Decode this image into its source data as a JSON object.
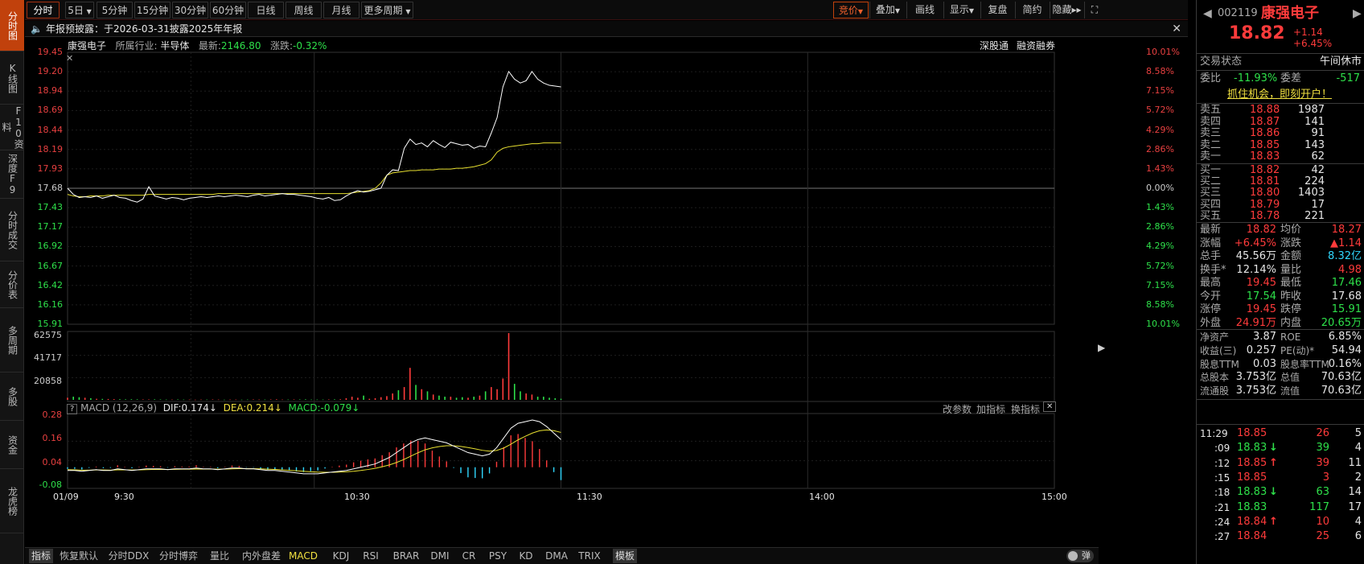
{
  "left_tabs": [
    "分时图",
    "K线图",
    "F10资料",
    "深度F9",
    "分时成交",
    "分价表",
    "多周期",
    "多股",
    "资金",
    "龙虎榜"
  ],
  "top_tabs": [
    "分时",
    "5日",
    "5分钟",
    "15分钟",
    "30分钟",
    "60分钟",
    "日线",
    "周线",
    "月线",
    "更多周期"
  ],
  "top_tools": [
    "竞价",
    "叠加",
    "画线",
    "显示",
    "复盘",
    "简约",
    "隐藏"
  ],
  "notice": "年报预披露：于2026-03-31披露2025年年报",
  "info": {
    "name": "康强电子",
    "industry_label": "所属行业:",
    "industry": "半导体",
    "latest_label": "最新:",
    "latest": "2146.80",
    "change_label": "涨跌:",
    "change": "-0.32%",
    "tag1": "深股通",
    "tag2": "融资融券"
  },
  "price_axis": {
    "left": [
      "19.45",
      "19.20",
      "18.94",
      "18.69",
      "18.44",
      "18.19",
      "17.93",
      "17.68",
      "17.43",
      "17.17",
      "16.92",
      "16.67",
      "16.42",
      "16.16",
      "15.91"
    ],
    "right": [
      "10.01%",
      "8.58%",
      "7.15%",
      "5.72%",
      "4.29%",
      "2.86%",
      "1.43%",
      "0.00%",
      "1.43%",
      "2.86%",
      "4.29%",
      "5.72%",
      "7.15%",
      "8.58%",
      "10.01%"
    ]
  },
  "volume_axis": [
    "62575",
    "41717",
    "20858"
  ],
  "macd": {
    "title": "MACD (12,26,9)",
    "dif": "DIF:0.174↓",
    "dea": "DEA:0.214↓",
    "macd": "MACD:-0.079↓",
    "btn1": "改参数",
    "btn2": "加指标",
    "btn3": "换指标",
    "axis": [
      "0.28",
      "0.16",
      "0.04",
      "-0.08"
    ]
  },
  "time_axis": [
    "01/09",
    "9:30",
    "10:30",
    "11:30",
    "14:00",
    "15:00"
  ],
  "bottom_tabs": [
    "指标",
    "恢复默认",
    "分时DDX",
    "分时博弈",
    "量比",
    "内外盘差",
    "MACD",
    "KDJ",
    "RSI",
    "BRAR",
    "DMI",
    "CR",
    "PSY",
    "KD",
    "DMA",
    "TRIX",
    "模板"
  ],
  "bottom_right": "弹",
  "chart_data": {
    "type": "line",
    "price_range": [
      15.91,
      19.45
    ],
    "prev_close": 17.68,
    "price": [
      17.68,
      17.6,
      17.56,
      17.57,
      17.56,
      17.58,
      17.55,
      17.57,
      17.59,
      17.56,
      17.55,
      17.52,
      17.5,
      17.54,
      17.7,
      17.58,
      17.56,
      17.54,
      17.56,
      17.55,
      17.53,
      17.55,
      17.56,
      17.57,
      17.56,
      17.57,
      17.58,
      17.57,
      17.58,
      17.59,
      17.58,
      17.57,
      17.59,
      17.6,
      17.58,
      17.59,
      17.6,
      17.61,
      17.6,
      17.6,
      17.59,
      17.58,
      17.57,
      17.55,
      17.54,
      17.56,
      17.52,
      17.53,
      17.58,
      17.62,
      17.65,
      17.63,
      17.64,
      17.66,
      17.68,
      17.85,
      17.92,
      17.91,
      18.2,
      18.32,
      18.25,
      18.27,
      18.22,
      18.3,
      18.25,
      18.21,
      18.28,
      18.26,
      18.24,
      18.25,
      18.2,
      18.23,
      18.22,
      18.4,
      18.6,
      19.0,
      19.2,
      19.1,
      19.05,
      19.08,
      19.2,
      19.1,
      19.05,
      19.02,
      19.01,
      19.0
    ],
    "avg_price": [
      17.6,
      17.58,
      17.57,
      17.57,
      17.58,
      17.58,
      17.58,
      17.59,
      17.59,
      17.59,
      17.59,
      17.59,
      17.59,
      17.59,
      17.6,
      17.6,
      17.6,
      17.6,
      17.6,
      17.6,
      17.6,
      17.6,
      17.6,
      17.6,
      17.6,
      17.6,
      17.61,
      17.61,
      17.61,
      17.61,
      17.61,
      17.61,
      17.61,
      17.61,
      17.61,
      17.61,
      17.61,
      17.61,
      17.61,
      17.61,
      17.61,
      17.61,
      17.61,
      17.61,
      17.61,
      17.61,
      17.61,
      17.61,
      17.61,
      17.62,
      17.63,
      17.64,
      17.65,
      17.68,
      17.75,
      17.85,
      17.88,
      17.89,
      17.9,
      17.91,
      17.91,
      17.92,
      17.92,
      17.92,
      17.93,
      17.93,
      17.93,
      17.94,
      17.94,
      17.95,
      17.96,
      17.98,
      18.0,
      18.05,
      18.15,
      18.2,
      18.22,
      18.23,
      18.24,
      18.25,
      18.26,
      18.26,
      18.27,
      18.27,
      18.27,
      18.27
    ],
    "volume_max": 62575,
    "volume": [
      2000,
      3000,
      2500,
      2000,
      1500,
      1000,
      900,
      800,
      700,
      600,
      500,
      600,
      500,
      400,
      400,
      500,
      400,
      300,
      300,
      400,
      300,
      300,
      200,
      300,
      300,
      400,
      300,
      200,
      300,
      300,
      200,
      300,
      400,
      300,
      300,
      400,
      500,
      300,
      300,
      400,
      400,
      500,
      300,
      300,
      300,
      400,
      500,
      600,
      1500,
      3000,
      2000,
      4000,
      1000,
      1500,
      2500,
      3500,
      6000,
      9000,
      12000,
      30000,
      14000,
      10000,
      8000,
      5000,
      4000,
      3000,
      3000,
      2000,
      2500,
      2000,
      3000,
      4000,
      8000,
      12000,
      10000,
      20000,
      62575,
      15000,
      8000,
      6000,
      5000,
      3000,
      3000,
      2000,
      1500,
      1000
    ],
    "macd_range": [
      -0.12,
      0.32
    ],
    "dif": [
      -0.02,
      -0.02,
      -0.025,
      -0.02,
      -0.015,
      -0.02,
      -0.02,
      -0.01,
      -0.015,
      -0.02,
      -0.015,
      -0.01,
      -0.01,
      -0.01,
      -0.015,
      -0.01,
      -0.01,
      -0.01,
      -0.005,
      -0.01,
      -0.01,
      -0.015,
      -0.01,
      -0.005,
      -0.005,
      -0.01,
      -0.01,
      -0.015,
      -0.02,
      -0.02,
      -0.025,
      -0.03,
      -0.035,
      -0.04,
      -0.04,
      -0.04,
      -0.035,
      -0.03,
      -0.025,
      -0.02,
      -0.01,
      0.0,
      0.01,
      0.02,
      0.04,
      0.06,
      0.09,
      0.12,
      0.15,
      0.17,
      0.18,
      0.17,
      0.16,
      0.15,
      0.13,
      0.11,
      0.09,
      0.08,
      0.07,
      0.08,
      0.12,
      0.18,
      0.24,
      0.27,
      0.28,
      0.29,
      0.28,
      0.25,
      0.21,
      0.17
    ],
    "dea": [
      -0.015,
      -0.016,
      -0.018,
      -0.018,
      -0.017,
      -0.017,
      -0.018,
      -0.016,
      -0.016,
      -0.017,
      -0.016,
      -0.015,
      -0.014,
      -0.013,
      -0.014,
      -0.013,
      -0.012,
      -0.012,
      -0.011,
      -0.011,
      -0.011,
      -0.012,
      -0.011,
      -0.01,
      -0.009,
      -0.009,
      -0.009,
      -0.01,
      -0.012,
      -0.014,
      -0.016,
      -0.019,
      -0.022,
      -0.025,
      -0.028,
      -0.03,
      -0.031,
      -0.031,
      -0.03,
      -0.028,
      -0.025,
      -0.02,
      -0.014,
      -0.007,
      0.003,
      0.014,
      0.029,
      0.047,
      0.068,
      0.089,
      0.107,
      0.119,
      0.127,
      0.132,
      0.132,
      0.128,
      0.121,
      0.113,
      0.104,
      0.099,
      0.103,
      0.118,
      0.142,
      0.168,
      0.19,
      0.21,
      0.224,
      0.229,
      0.225,
      0.214
    ],
    "macd_hist": [
      -0.01,
      -0.01,
      -0.014,
      -0.004,
      0.004,
      -0.006,
      -0.004,
      0.012,
      0.002,
      -0.006,
      0.002,
      0.01,
      0.008,
      0.006,
      -0.002,
      0.006,
      0.004,
      0.004,
      0.012,
      0.002,
      0.002,
      -0.006,
      0.002,
      0.01,
      0.008,
      -0.002,
      -0.002,
      -0.01,
      -0.016,
      -0.012,
      -0.018,
      -0.022,
      -0.026,
      -0.03,
      -0.024,
      -0.02,
      -0.008,
      0.002,
      0.01,
      0.016,
      0.03,
      0.04,
      0.048,
      0.054,
      0.074,
      0.092,
      0.122,
      0.146,
      0.164,
      0.162,
      0.146,
      0.102,
      0.066,
      0.036,
      -0.004,
      -0.036,
      -0.062,
      -0.066,
      -0.068,
      -0.038,
      0.034,
      0.124,
      0.196,
      0.204,
      0.18,
      0.16,
      0.112,
      0.042,
      -0.03,
      -0.079
    ]
  },
  "quote": {
    "code": "002119",
    "name": "康强电子",
    "price": "18.82",
    "change": "+1.14",
    "pct": "+6.45%"
  },
  "status": {
    "label": "交易状态",
    "value": "午间休市"
  },
  "weibi": {
    "label": "委比",
    "value": "-11.93%",
    "label2": "委差",
    "value2": "-517"
  },
  "promo": "抓住机会，即刻开户！",
  "asks": [
    {
      "label": "卖五",
      "price": "18.88",
      "vol": "1987"
    },
    {
      "label": "卖四",
      "price": "18.87",
      "vol": "141"
    },
    {
      "label": "卖三",
      "price": "18.86",
      "vol": "91"
    },
    {
      "label": "卖二",
      "price": "18.85",
      "vol": "143"
    },
    {
      "label": "卖一",
      "price": "18.83",
      "vol": "62"
    }
  ],
  "bids": [
    {
      "label": "买一",
      "price": "18.82",
      "vol": "42"
    },
    {
      "label": "买二",
      "price": "18.81",
      "vol": "224"
    },
    {
      "label": "买三",
      "price": "18.80",
      "vol": "1403"
    },
    {
      "label": "买四",
      "price": "18.79",
      "vol": "17"
    },
    {
      "label": "买五",
      "price": "18.78",
      "vol": "221"
    }
  ],
  "stats": [
    {
      "l1": "最新",
      "v1": "18.82",
      "c1": "red",
      "l2": "均价",
      "v2": "18.27",
      "c2": "red"
    },
    {
      "l1": "涨幅",
      "v1": "+6.45%",
      "c1": "red",
      "l2": "涨跌",
      "v2": "▲1.14",
      "c2": "red"
    },
    {
      "l1": "总手",
      "v1": "45.56万",
      "c1": "wht",
      "l2": "金额",
      "v2": "8.32亿",
      "c2": "cyn"
    },
    {
      "l1": "换手*",
      "v1": "12.14%",
      "c1": "wht",
      "l2": "量比",
      "v2": "4.98",
      "c2": "red"
    },
    {
      "l1": "最高",
      "v1": "19.45",
      "c1": "red",
      "l2": "最低",
      "v2": "17.46",
      "c2": "grn"
    },
    {
      "l1": "今开",
      "v1": "17.54",
      "c1": "grn",
      "l2": "昨收",
      "v2": "17.68",
      "c2": "wht"
    },
    {
      "l1": "涨停",
      "v1": "19.45",
      "c1": "red",
      "l2": "跌停",
      "v2": "15.91",
      "c2": "grn"
    },
    {
      "l1": "外盘",
      "v1": "24.91万",
      "c1": "red",
      "l2": "内盘",
      "v2": "20.65万",
      "c2": "grn"
    }
  ],
  "fund": [
    {
      "l1": "净资产",
      "v1": "3.87",
      "l2": "ROE",
      "v2": "6.85%"
    },
    {
      "l1": "收益(三)",
      "v1": "0.257",
      "l2": "PE(动)*",
      "v2": "54.94"
    },
    {
      "l1": "股息TTM",
      "v1": "0.03",
      "l2": "股息率TTM",
      "v2": "0.16%"
    },
    {
      "l1": "总股本",
      "v1": "3.753亿",
      "l2": "总值",
      "v2": "70.63亿"
    },
    {
      "l1": "流通股",
      "v1": "3.753亿",
      "l2": "流值",
      "v2": "70.63亿"
    }
  ],
  "ticks": [
    {
      "t": "11:29",
      "p": "18.85",
      "a": "",
      "v": "26",
      "n": "5",
      "c": "red"
    },
    {
      "t": ":09",
      "p": "18.83",
      "a": "↓",
      "v": "39",
      "n": "4",
      "c": "grn"
    },
    {
      "t": ":12",
      "p": "18.85",
      "a": "↑",
      "v": "39",
      "n": "11",
      "c": "red"
    },
    {
      "t": ":15",
      "p": "18.85",
      "a": "",
      "v": "3",
      "n": "2",
      "c": "red"
    },
    {
      "t": ":18",
      "p": "18.83",
      "a": "↓",
      "v": "63",
      "n": "14",
      "c": "grn"
    },
    {
      "t": ":21",
      "p": "18.83",
      "a": "",
      "v": "117",
      "n": "17",
      "c": "grn"
    },
    {
      "t": ":24",
      "p": "18.84",
      "a": "↑",
      "v": "10",
      "n": "4",
      "c": "red"
    },
    {
      "t": ":27",
      "p": "18.84",
      "a": "",
      "v": "25",
      "n": "6",
      "c": "red"
    }
  ]
}
